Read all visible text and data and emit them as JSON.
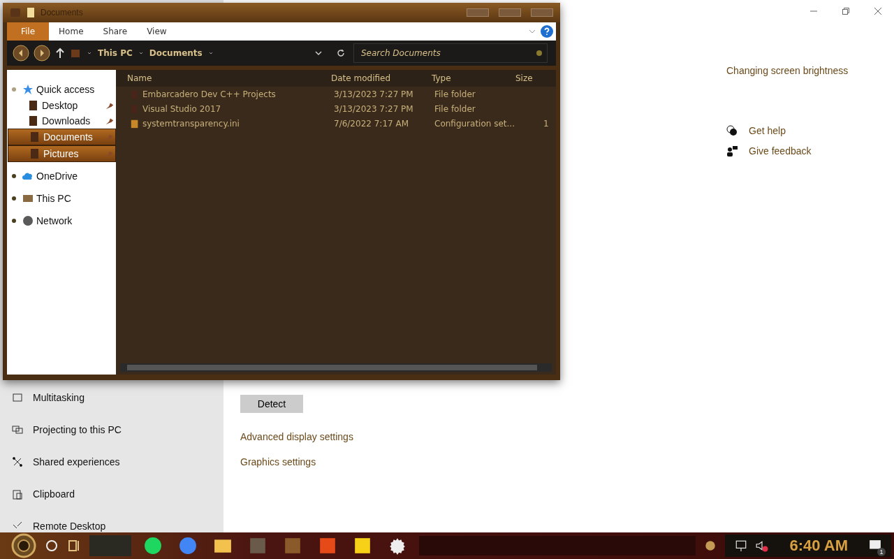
{
  "settings": {
    "sidebar": [
      {
        "label": "Multitasking"
      },
      {
        "label": "Projecting to this PC"
      },
      {
        "label": "Shared experiences"
      },
      {
        "label": "Clipboard"
      },
      {
        "label": "Remote Desktop"
      }
    ],
    "detect_button": "Detect",
    "links": [
      "Advanced display settings",
      "Graphics settings"
    ],
    "related": "Changing screen brightness",
    "help": [
      {
        "label": "Get help"
      },
      {
        "label": "Give feedback"
      }
    ]
  },
  "explorer": {
    "title": "Documents",
    "ribbon_tabs": [
      {
        "label": "File",
        "selected": true
      },
      {
        "label": "Home",
        "selected": false
      },
      {
        "label": "Share",
        "selected": false
      },
      {
        "label": "View",
        "selected": false
      }
    ],
    "breadcrumb": [
      "This PC",
      "Documents"
    ],
    "search": {
      "placeholder": "Search Documents"
    },
    "nav": [
      {
        "label": "Quick access",
        "expanded": true,
        "children": [
          {
            "label": "Desktop",
            "selected": false
          },
          {
            "label": "Downloads",
            "selected": false
          },
          {
            "label": "Documents",
            "selected": true
          },
          {
            "label": "Pictures",
            "selected": true
          }
        ]
      },
      {
        "label": "OneDrive",
        "expanded": false
      },
      {
        "label": "This PC",
        "expanded": false
      },
      {
        "label": "Network",
        "expanded": false
      }
    ],
    "columns": [
      "Name",
      "Date modified",
      "Type",
      "Size"
    ],
    "rows": [
      {
        "kind": "folder",
        "name": "Embarcadero Dev C++ Projects",
        "date": "3/13/2023 7:27 PM",
        "type": "File folder"
      },
      {
        "kind": "folder",
        "name": "Visual Studio 2017",
        "date": "3/13/2023 7:27 PM",
        "type": "File folder"
      },
      {
        "kind": "file",
        "name": "systemtransparency.ini",
        "date": "7/6/2022 7:17 AM",
        "type": "Configuration set...",
        "size": "1"
      }
    ]
  },
  "taskbar": {
    "clock": "6:40 AM",
    "notifications": "1"
  }
}
